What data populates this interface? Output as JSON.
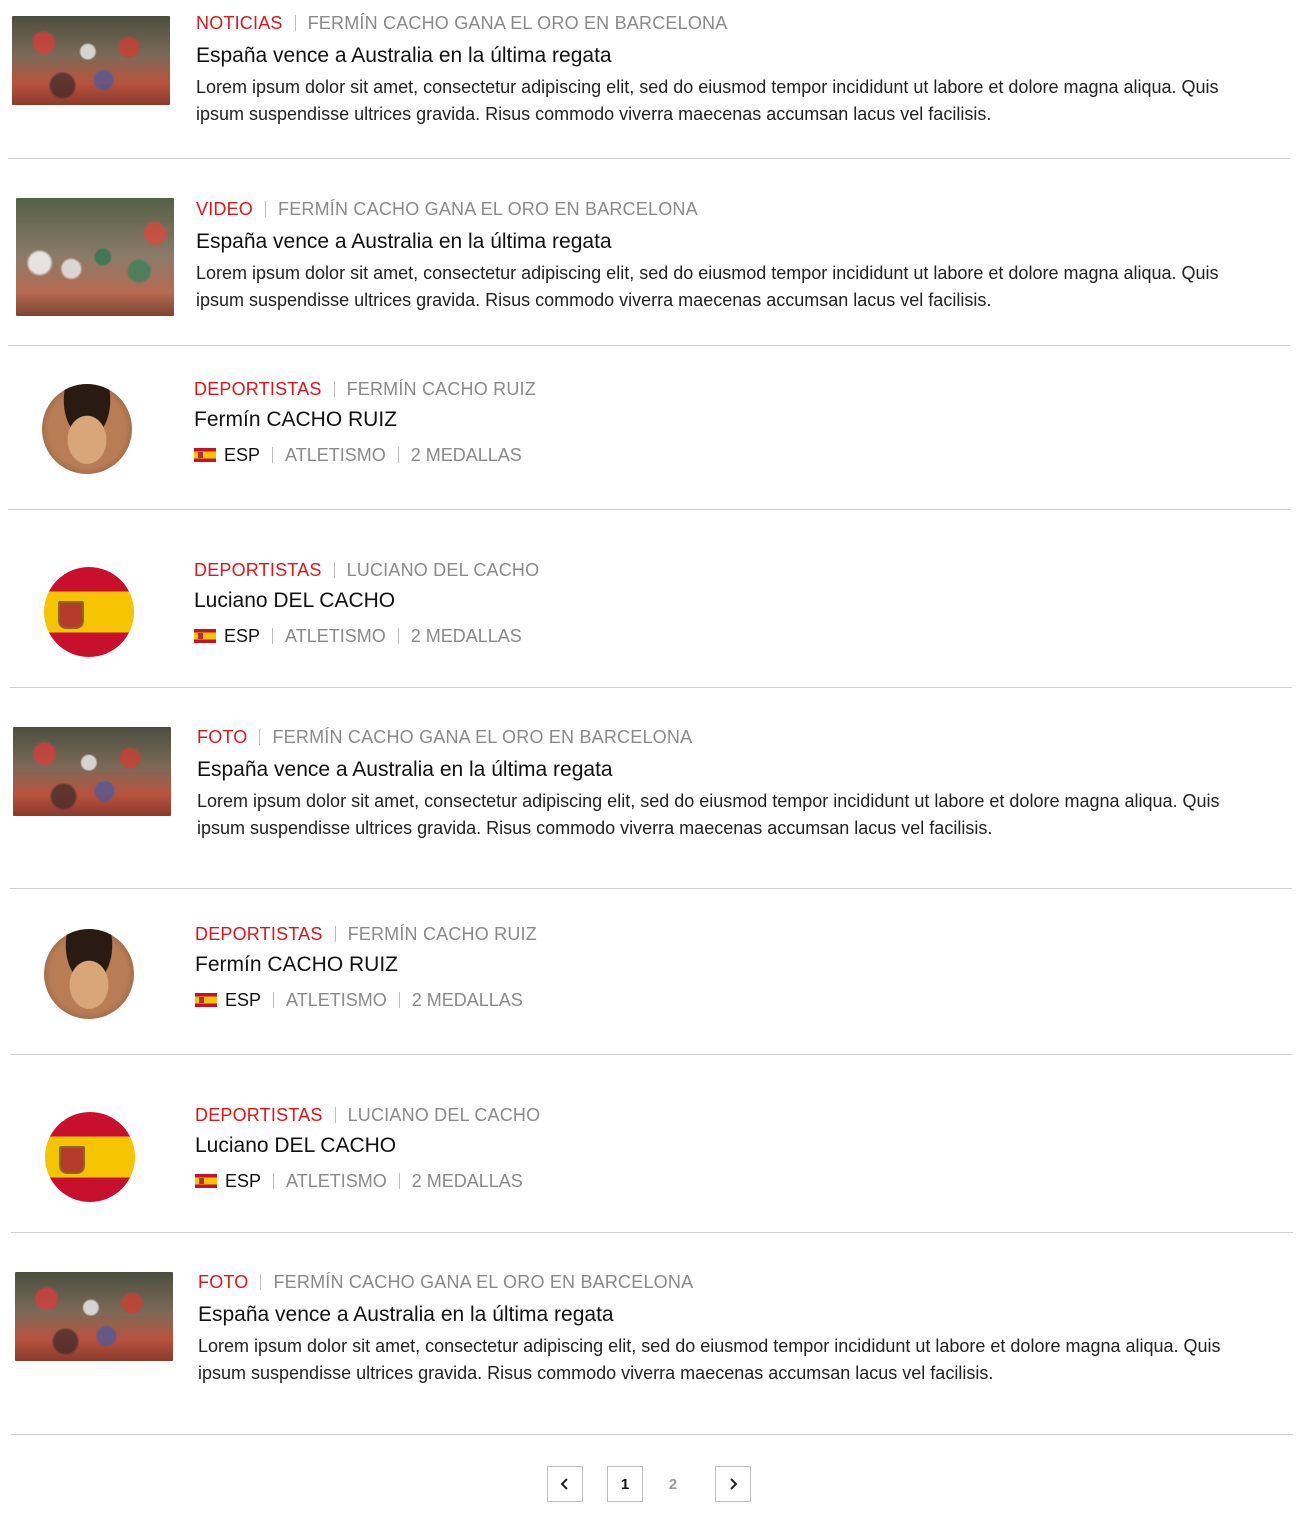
{
  "items": [
    {
      "type": "article",
      "category": "NOTICIAS",
      "subtitle": "FERMÍN CACHO GANA EL ORO EN BARCELONA",
      "title": "España vence a Australia en la última regata",
      "description": "Lorem ipsum dolor sit amet, consectetur adipiscing elit, sed do eiusmod tempor incididunt ut labore et dolore magna aliqua. Quis ipsum suspendisse ultrices gravida. Risus commodo viverra maecenas accumsan lacus vel facilisis."
    },
    {
      "type": "article",
      "category": "VIDEO",
      "subtitle": "FERMÍN CACHO GANA EL ORO EN BARCELONA",
      "title": "España vence a Australia en la última regata",
      "description": "Lorem ipsum dolor sit amet, consectetur adipiscing elit, sed do eiusmod tempor incididunt ut labore et dolore magna aliqua. Quis ipsum suspendisse ultrices gravida. Risus commodo viverra maecenas accumsan lacus vel facilisis."
    },
    {
      "type": "athlete",
      "category": "DEPORTISTAS",
      "subtitle": "FERMÍN CACHO RUIZ",
      "name": "Fermín CACHO RUIZ",
      "country": "ESP",
      "sport": "ATLETISMO",
      "medals": "2 MEDALLAS",
      "avatar": "face"
    },
    {
      "type": "athlete",
      "category": "DEPORTISTAS",
      "subtitle": "LUCIANO DEL CACHO",
      "name": "Luciano DEL CACHO",
      "country": "ESP",
      "sport": "ATLETISMO",
      "medals": "2 MEDALLAS",
      "avatar": "flag"
    },
    {
      "type": "article",
      "category": "FOTO",
      "subtitle": "FERMÍN CACHO GANA EL ORO EN BARCELONA",
      "title": "España vence a Australia en la última regata",
      "description": "Lorem ipsum dolor sit amet, consectetur adipiscing elit, sed do eiusmod tempor incididunt ut labore et dolore magna aliqua. Quis ipsum suspendisse ultrices gravida. Risus commodo viverra maecenas accumsan lacus vel facilisis."
    },
    {
      "type": "athlete",
      "category": "DEPORTISTAS",
      "subtitle": "FERMÍN CACHO RUIZ",
      "name": "Fermín CACHO RUIZ",
      "country": "ESP",
      "sport": "ATLETISMO",
      "medals": "2 MEDALLAS",
      "avatar": "face"
    },
    {
      "type": "athlete",
      "category": "DEPORTISTAS",
      "subtitle": "LUCIANO DEL CACHO",
      "name": "Luciano DEL CACHO",
      "country": "ESP",
      "sport": "ATLETISMO",
      "medals": "2 MEDALLAS",
      "avatar": "flag"
    },
    {
      "type": "article",
      "category": "FOTO",
      "subtitle": "FERMÍN CACHO GANA EL ORO EN BARCELONA",
      "title": "España vence a Australia en la última regata",
      "description": "Lorem ipsum dolor sit amet, consectetur adipiscing elit, sed do eiusmod tempor incididunt ut labore et dolore magna aliqua. Quis ipsum suspendisse ultrices gravida. Risus commodo viverra maecenas accumsan lacus vel facilisis."
    }
  ],
  "pagination": {
    "prev_icon": "chevron-left-icon",
    "pages": [
      "1",
      "2"
    ],
    "current": "1",
    "next_icon": "chevron-right-icon"
  },
  "colors": {
    "accent": "#e0151b",
    "muted": "#8a8a8a",
    "separator": "#cfcfcf"
  }
}
